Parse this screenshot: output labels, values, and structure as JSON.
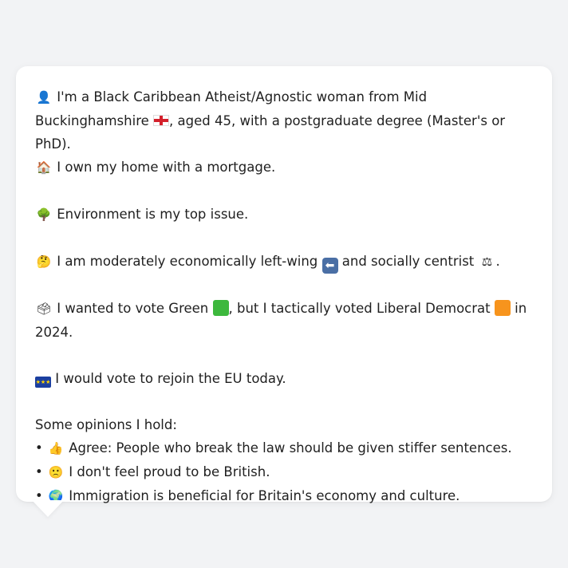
{
  "profile": {
    "line1_emoji": "👤",
    "line1_text": " I'm a Black Caribbean Atheist/Agnostic woman from Mid",
    "line2_text_a": "Buckinghamshire ",
    "line2_flag": "England flag",
    "line2_text_b": ", aged 45, with a postgraduate degree (Master's or PhD).",
    "line3_emoji": "🏠",
    "line3_text": " I own my home with a mortgage.",
    "issue_emoji": "🌳",
    "issue_text": " Environment is my top issue.",
    "ideology_emoji": "🤔",
    "ideology_text_a": " I am moderately economically left-wing ",
    "ideology_arrow": "⬅",
    "ideology_text_b": " and socially centrist ",
    "ideology_scale": "⚖",
    "ideology_text_c": ".",
    "vote_emoji": "🗳",
    "vote_text_a": " I wanted to vote Green ",
    "green_color": "#3db83d",
    "vote_text_b": ", but I tactically voted Liberal Democrat ",
    "libdem_color": "#f7941d",
    "vote_text_c": " in",
    "vote_text_d": "2024.",
    "eu_flag": "EU flag",
    "eu_text": " I would vote to rejoin the EU today.",
    "opinions_header": "Some opinions I hold:",
    "opinions": [
      {
        "bullet": "• ",
        "emoji": "👍",
        "text": " Agree: People who break the law should be given stiffer sentences."
      },
      {
        "bullet": "• ",
        "emoji": "🙁",
        "text": " I don't feel proud to be British."
      },
      {
        "bullet": "• ",
        "emoji": "🌍",
        "text": " Immigration is beneficial for Britain's economy and culture."
      }
    ]
  },
  "colors": {
    "background": "#f2f3f5",
    "card": "#ffffff",
    "text": "#1f1f1f"
  }
}
